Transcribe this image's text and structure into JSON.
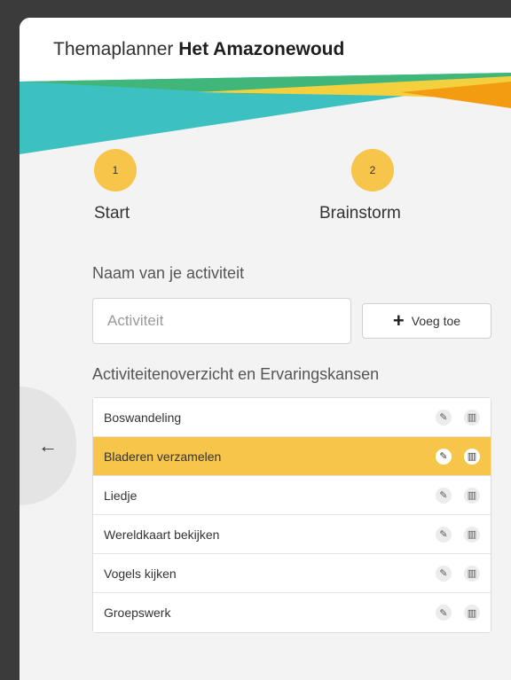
{
  "header": {
    "title_prefix": "Themaplanner",
    "title_bold": "Het Amazonewoud"
  },
  "banner": {
    "colors": [
      "#3cc0c0",
      "#41b67a",
      "#f4d03f",
      "#f39c12"
    ]
  },
  "steps": [
    {
      "number": "1",
      "label": "Start"
    },
    {
      "number": "2",
      "label": "Brainstorm"
    }
  ],
  "form": {
    "field_label": "Naam van je activiteit",
    "input_placeholder": "Activiteit",
    "input_value": "",
    "add_button_label": "Voeg toe"
  },
  "activities": {
    "heading": "Activiteitenoverzicht en Ervaringskansen",
    "items": [
      {
        "label": "Boswandeling",
        "selected": false
      },
      {
        "label": "Bladeren verzamelen",
        "selected": true
      },
      {
        "label": "Liedje",
        "selected": false
      },
      {
        "label": "Wereldkaart bekijken",
        "selected": false
      },
      {
        "label": "Vogels kijken",
        "selected": false
      },
      {
        "label": "Groepswerk",
        "selected": false
      }
    ]
  },
  "icons": {
    "edit": "pencil-icon",
    "delete": "trash-icon",
    "back": "arrow-left-icon",
    "add": "plus-icon"
  },
  "accent_color": "#f6c54a"
}
